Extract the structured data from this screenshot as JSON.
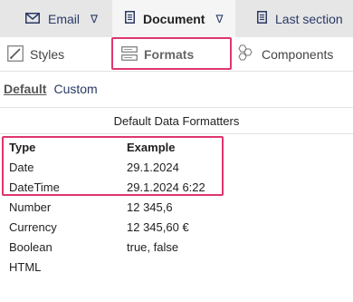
{
  "top_tabs": [
    {
      "label": "Email",
      "icon": "envelope-icon",
      "chevron": "∇",
      "active": false
    },
    {
      "label": "Document",
      "icon": "document-icon",
      "chevron": "∇",
      "active": true
    },
    {
      "label": "Last section",
      "icon": "document-icon",
      "active": false
    }
  ],
  "sub_tabs": [
    {
      "label": "Styles",
      "icon": "pencil-icon",
      "active": false
    },
    {
      "label": "Formats",
      "icon": "formats-icon",
      "active": true
    },
    {
      "label": "Components",
      "icon": "hexagons-icon",
      "active": false
    }
  ],
  "switch": {
    "default_label": "Default",
    "custom_label": "Custom",
    "selected": "Default"
  },
  "panel": {
    "title": "Default Data Formatters",
    "columns": [
      "Type",
      "Example"
    ],
    "rows": [
      {
        "type": "Date",
        "example": "29.1.2024"
      },
      {
        "type": "DateTime",
        "example": "29.1.2024 6:22"
      },
      {
        "type": "Number",
        "example": "12 345,6"
      },
      {
        "type": "Currency",
        "example": "12 345,60 €"
      },
      {
        "type": "Boolean",
        "example": "true, false"
      },
      {
        "type": "HTML",
        "example": ""
      }
    ]
  },
  "colors": {
    "highlight": "#e0356e",
    "tab_text": "#2a3a66",
    "topbar_bg": "#e6e6e6"
  }
}
